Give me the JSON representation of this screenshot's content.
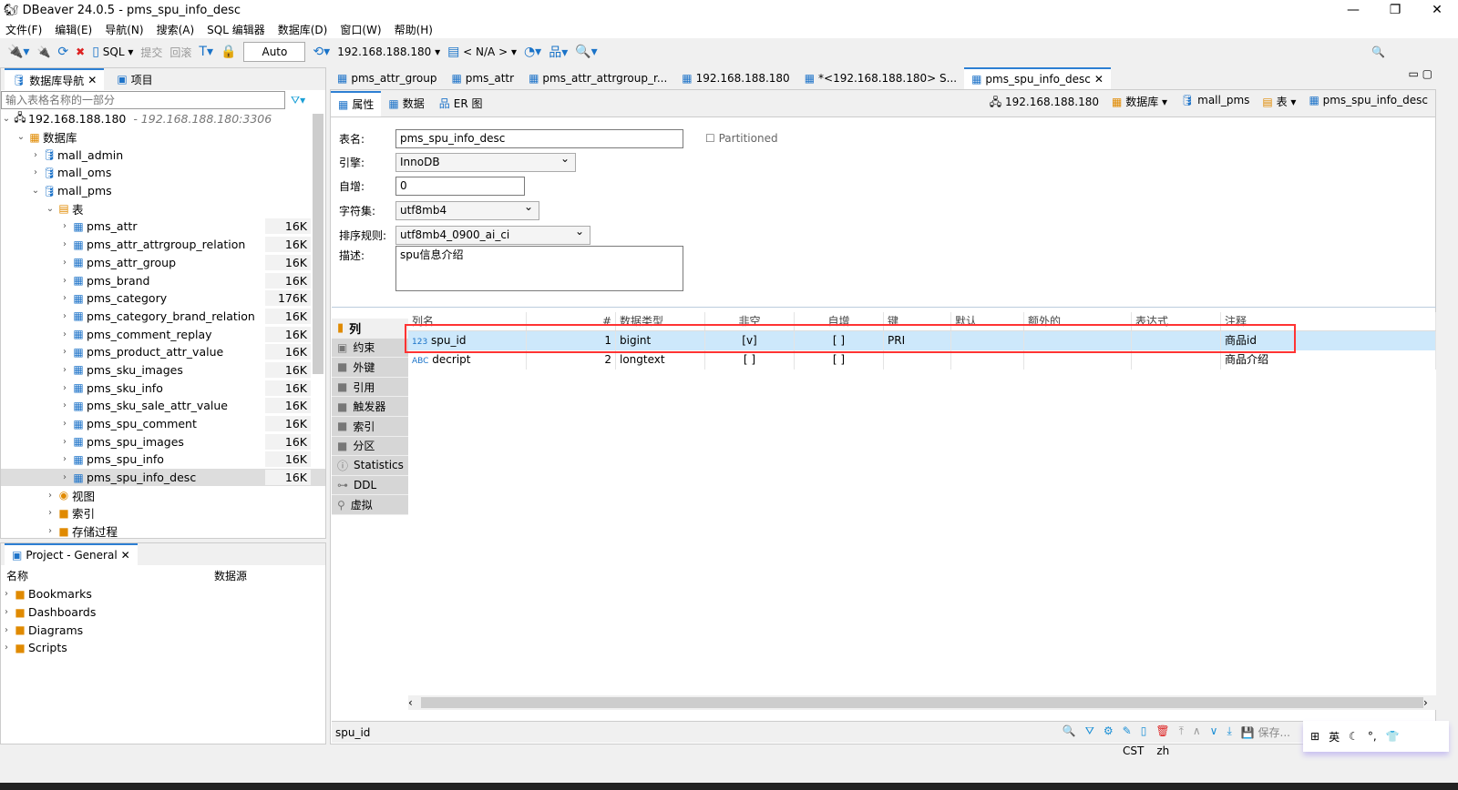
{
  "window": {
    "title": "DBeaver 24.0.5 - pms_spu_info_desc"
  },
  "menu": [
    "文件(F)",
    "编辑(E)",
    "导航(N)",
    "搜索(A)",
    "SQL 编辑器",
    "数据库(D)",
    "窗口(W)",
    "帮助(H)"
  ],
  "toolbar": {
    "sql": "SQL",
    "commit": "提交",
    "rollback": "回滚",
    "mode": "Auto",
    "connection": "192.168.188.180",
    "schema": "< N/A >"
  },
  "navigator": {
    "tab1": "数据库导航",
    "tab2": "项目",
    "filter_placeholder": "输入表格名称的一部分",
    "connection": "192.168.188.180",
    "connection_url": "- 192.168.188.180:3306",
    "databases_label": "数据库",
    "dbs": [
      "mall_admin",
      "mall_oms",
      "mall_pms"
    ],
    "tables_label": "表",
    "tables": [
      [
        "pms_attr",
        "16K"
      ],
      [
        "pms_attr_attrgroup_relation",
        "16K"
      ],
      [
        "pms_attr_group",
        "16K"
      ],
      [
        "pms_brand",
        "16K"
      ],
      [
        "pms_category",
        "176K"
      ],
      [
        "pms_category_brand_relation",
        "16K"
      ],
      [
        "pms_comment_replay",
        "16K"
      ],
      [
        "pms_product_attr_value",
        "16K"
      ],
      [
        "pms_sku_images",
        "16K"
      ],
      [
        "pms_sku_info",
        "16K"
      ],
      [
        "pms_sku_sale_attr_value",
        "16K"
      ],
      [
        "pms_spu_comment",
        "16K"
      ],
      [
        "pms_spu_images",
        "16K"
      ],
      [
        "pms_spu_info",
        "16K"
      ],
      [
        "pms_spu_info_desc",
        "16K"
      ]
    ],
    "others": [
      "视图",
      "索引",
      "存储过程"
    ]
  },
  "project": {
    "tab": "Project - General",
    "col_name": "名称",
    "col_source": "数据源",
    "items": [
      "Bookmarks",
      "Dashboards",
      "Diagrams",
      "Scripts"
    ]
  },
  "editor_tabs": [
    "pms_attr_group",
    "pms_attr",
    "pms_attr_attrgroup_r...",
    "192.168.188.180",
    "*<192.168.188.180> S...",
    "pms_spu_info_desc"
  ],
  "sub_tabs": [
    "属性",
    "数据",
    "ER 图"
  ],
  "breadcrumb": [
    "192.168.188.180",
    "数据库",
    "mall_pms",
    "表",
    "pms_spu_info_desc"
  ],
  "props": {
    "name_label": "表名:",
    "name": "pms_spu_info_desc",
    "partitioned": "Partitioned",
    "engine_label": "引擎:",
    "engine": "InnoDB",
    "autoinc_label": "自增:",
    "autoinc": "0",
    "charset_label": "字符集:",
    "charset": "utf8mb4",
    "collation_label": "排序规则:",
    "collation": "utf8mb4_0900_ai_ci",
    "desc_label": "描述:",
    "desc": "spu信息介绍"
  },
  "side_tabs": [
    "列",
    "约束",
    "外键",
    "引用",
    "触发器",
    "索引",
    "分区",
    "Statistics",
    "DDL",
    "虚拟"
  ],
  "columns": {
    "headers": [
      "列名",
      "#",
      "数据类型",
      "非空",
      "自增",
      "键",
      "默认",
      "额外的",
      "表达式",
      "注释"
    ],
    "rows": [
      [
        "spu_id",
        "1",
        "bigint",
        "[v]",
        "[ ]",
        "PRI",
        "",
        "",
        "",
        "商品id"
      ],
      [
        "decript",
        "2",
        "longtext",
        "[ ]",
        "[ ]",
        "",
        "",
        "",
        "",
        "商品介绍"
      ]
    ]
  },
  "status": {
    "selected": "spu_id",
    "save": "保存...",
    "tz": "CST",
    "locale": "zh",
    "ime": "英"
  },
  "colors": {
    "accent": "#2d7fd3",
    "highlight": "#ff3333",
    "selected_row": "#cde8fb"
  }
}
